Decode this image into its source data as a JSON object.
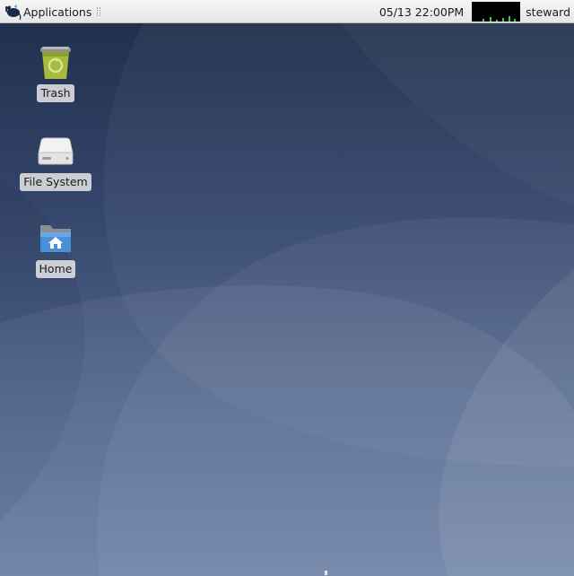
{
  "panel": {
    "applications_label": "Applications",
    "clock": "05/13 22:00PM",
    "user": "steward",
    "cpu_monitor_icon": "cpu-graph-icon"
  },
  "desktop": {
    "icons": [
      {
        "label": "Trash",
        "icon": "trash-icon"
      },
      {
        "label": "File System",
        "icon": "drive-icon"
      },
      {
        "label": "Home",
        "icon": "home-folder-icon"
      }
    ]
  },
  "colors": {
    "panel_bg": "#ececec",
    "wallpaper_dark": "#1f2d4a",
    "wallpaper_light": "#6a7fa5",
    "trash_green": "#a6bb3c",
    "folder_blue": "#4a90d9"
  }
}
